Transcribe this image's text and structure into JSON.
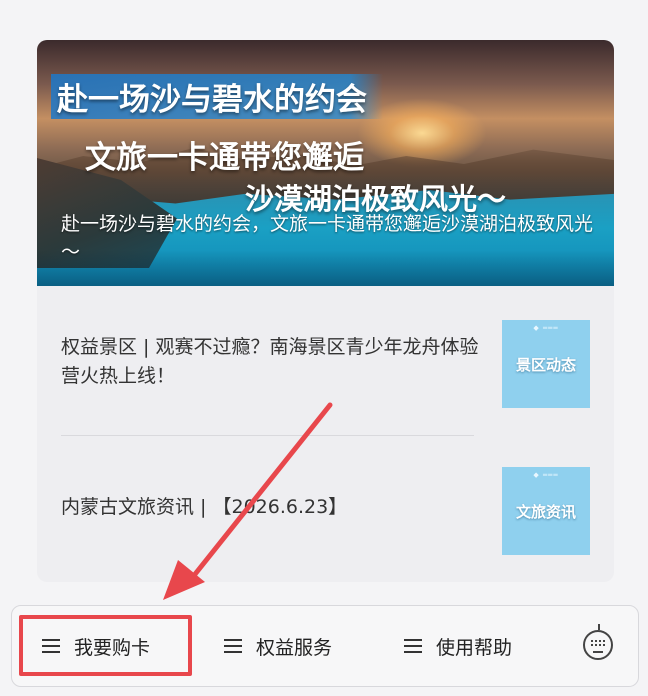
{
  "hero": {
    "headline_line1": "赴一场沙与碧水的约会",
    "headline_line2": "文旅一卡通带您邂逅",
    "headline_line3": "沙漠湖泊极致风光～",
    "caption": "赴一场沙与碧水的约会，文旅一卡通带您邂逅沙漠湖泊极致风光～"
  },
  "news": [
    {
      "title": "权益景区 | 观赛不过瘾？南海景区青少年龙舟体验营火热上线！",
      "thumb_label": "景区动态"
    },
    {
      "title": "内蒙古文旅资讯 | 【2026.6.23】",
      "thumb_label": "文旅资讯"
    }
  ],
  "menu": {
    "items": [
      {
        "label": "我要购卡",
        "icon": "hamburger-icon"
      },
      {
        "label": "权益服务",
        "icon": "hamburger-icon"
      },
      {
        "label": "使用帮助",
        "icon": "hamburger-icon"
      }
    ],
    "keyboard_icon": "keyboard-icon"
  },
  "colors": {
    "highlight": "#e8474c",
    "thumb_bg": "#8fd0ee",
    "card_bg": "#eeeef1"
  }
}
